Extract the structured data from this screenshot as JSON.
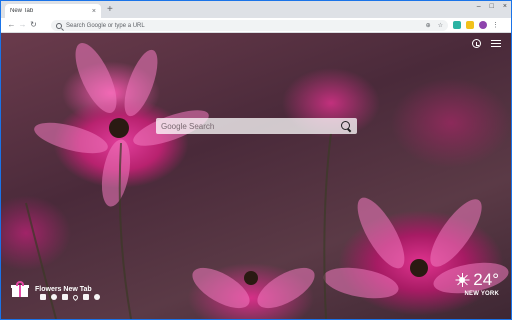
{
  "browser": {
    "tab_title": "New Tab",
    "tab_close": "×",
    "new_tab": "+",
    "window_controls": [
      "–",
      "□",
      "×"
    ],
    "omnibox_placeholder": "Search Google or type a URL",
    "icons": [
      "back-icon",
      "forward-icon",
      "reload-icon",
      "search-icon",
      "share-icon",
      "star-icon",
      "extension-icon",
      "profile-icon",
      "menu-icon"
    ]
  },
  "page": {
    "search_placeholder": "Google Search",
    "brand_title": "Flowers New Tab",
    "tool_icons": [
      "brush-icon",
      "settings-icon",
      "microphone-icon",
      "heart-icon",
      "gallery-icon",
      "share-icon"
    ],
    "weather": {
      "temperature": "24°",
      "city": "NEW YORK",
      "icon": "sun-icon"
    }
  }
}
